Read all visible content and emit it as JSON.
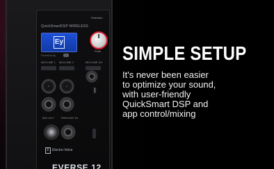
{
  "hero": {
    "headline": "SIMPLE SETUP",
    "body_lines": [
      "It's never been easier",
      "to optimize your sound,",
      "with user-friendly",
      "QuickSmart DSP and",
      "app control/mixing"
    ]
  },
  "speaker": {
    "panel_model_text": "QuickSmartDSP WIRELESS",
    "lcd_logo": "Ey",
    "powered_text": "Powered by",
    "knob_label": "Selection",
    "knob_sub_label": "Push",
    "channel_labels": [
      "MIC/LINE 1",
      "MIC/LINE 2",
      "MIC/LINE 3/4"
    ],
    "output_labels": [
      "MIX OUT",
      "THRU/SAT IN"
    ],
    "brand_text": "Electro-Voice",
    "model_name": "EVERSE 12",
    "icons": [
      "ev-logo-icon",
      "bluetooth-icon"
    ]
  },
  "colors": {
    "background": "#000000",
    "headline": "#ffffff",
    "body": "#f2f2f2",
    "lcd": "#1d4fd6",
    "knob_ring": "#d21a2f"
  }
}
